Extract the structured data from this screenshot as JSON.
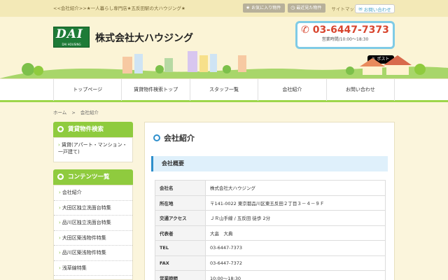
{
  "topbar": {
    "tagline": "<<会社紹介>>★一人暮らし専門店★五反田駅の大ハウジング★",
    "favorites_label": "お気に入り物件",
    "recent_label": "最近見た物件",
    "sitemap_label": "サイトマップ",
    "contact_label": "お問い合わせ"
  },
  "header": {
    "logo_text": "DAI",
    "logo_sub": "DAI HOUSING",
    "company_name": "株式会社大ハウジング",
    "phone": "03-6447-7373",
    "hours": "営業時間/10:00～18:30",
    "post_label": "ポスト"
  },
  "nav": {
    "items": [
      "トップページ",
      "賃貸物件検索トップ",
      "スタッフ一覧",
      "会社紹介",
      "お問い合わせ"
    ]
  },
  "breadcrumb": {
    "home": "ホーム",
    "sep": ">",
    "current": "会社紹介"
  },
  "sidebar": {
    "rental_head": "賃貸物件検索",
    "rental_item": "賃貸(アパート・マンション・一戸建て)",
    "contents_head": "コンテンツ一覧",
    "contents": [
      "会社紹介",
      "大田区独立洗面台特集",
      "品川区独立洗面台特集",
      "大田区築浅物件特集",
      "品川区築浅物件特集",
      "浅草線特集"
    ]
  },
  "main": {
    "title": "会社紹介",
    "section": "会社概要",
    "rows": [
      {
        "k": "会社名",
        "v": "株式会社大ハウジング"
      },
      {
        "k": "所在地",
        "v": "〒141-0022 東京都品川区東五反田２丁目３－４－９Ｆ"
      },
      {
        "k": "交通アクセス",
        "v": "ＪＲ山手線 / 五反田 徒歩 2分"
      },
      {
        "k": "代表者",
        "v": "大畠　大典"
      },
      {
        "k": "TEL",
        "v": "03-6447-7373"
      },
      {
        "k": "FAX",
        "v": "03-6447-7372"
      },
      {
        "k": "営業時間",
        "v": "10:00～18:30"
      }
    ]
  },
  "colors": {
    "accent_green": "#8fcb3e",
    "accent_blue": "#2e8fcc",
    "phone_red": "#d8452e",
    "logo_green": "#1e7b37"
  }
}
